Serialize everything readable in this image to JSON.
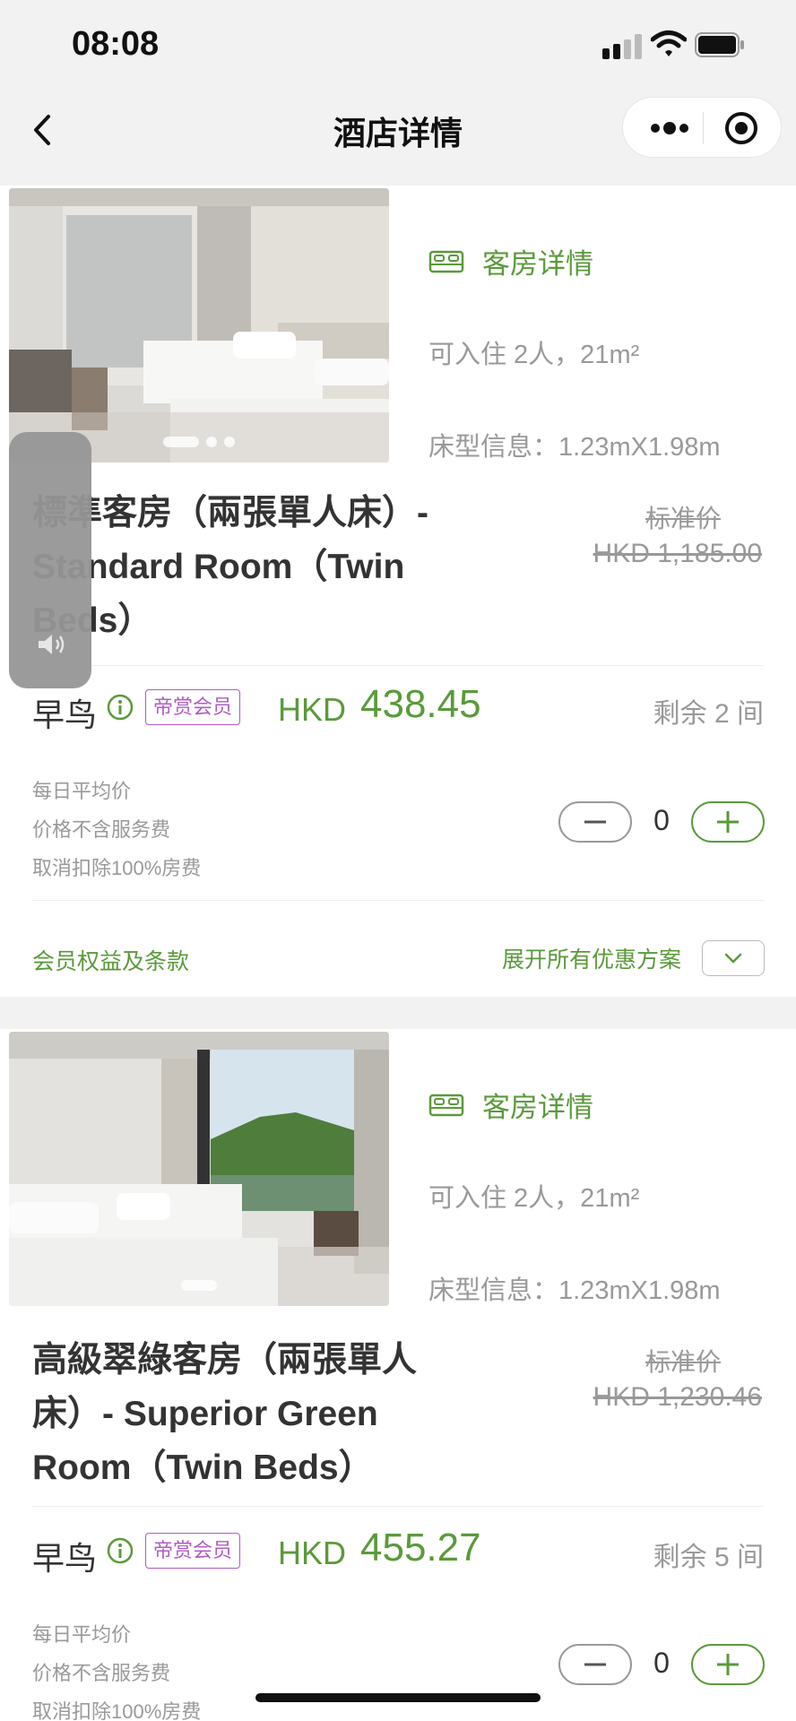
{
  "status_bar": {
    "time": "08:08",
    "icons": [
      "signal-icon",
      "wifi-icon",
      "battery-icon"
    ]
  },
  "nav": {
    "title": "酒店详情",
    "icons": [
      "back-icon",
      "more-icon",
      "target-icon"
    ]
  },
  "rooms": [
    {
      "details_label": "客房详情",
      "occupancy": "可入住 2人，21m²",
      "bed_info": "床型信息：1.23mX1.98m",
      "name_line1": "標準客房（兩張單人床）-",
      "name_line2": "Standard Room（Twin",
      "name_line3": "Beds）",
      "std_price_label": "标准价",
      "std_price": "HKD 1,185.00",
      "rate_name": "早鸟",
      "member_badge": "帝赏会员",
      "currency": "HKD",
      "price": "438.45",
      "remaining": "剩余 2 间",
      "notes": [
        "每日平均价",
        "价格不含服务费",
        "取消扣除100%房费"
      ],
      "quantity": "0",
      "terms_label": "会员权益及条款",
      "expand_label": "展开所有优惠方案",
      "photo_dots": 3
    },
    {
      "details_label": "客房详情",
      "occupancy": "可入住 2人，21m²",
      "bed_info": "床型信息：1.23mX1.98m",
      "name_line1": "高級翠綠客房（兩張單人",
      "name_line2": "床）- Superior Green",
      "name_line3": "Room（Twin Beds）",
      "std_price_label": "标准价",
      "std_price": "HKD 1,230.46",
      "rate_name": "早鸟",
      "member_badge": "帝赏会员",
      "currency": "HKD",
      "price": "455.27",
      "remaining": "剩余 5 间",
      "notes": [
        "每日平均价",
        "价格不含服务费",
        "取消扣除100%房费"
      ],
      "quantity": "0",
      "photo_dots": 1
    }
  ],
  "colors": {
    "accent_green": "#5a9a3a",
    "member_purple": "#b05cc4",
    "muted_text": "#999999"
  }
}
